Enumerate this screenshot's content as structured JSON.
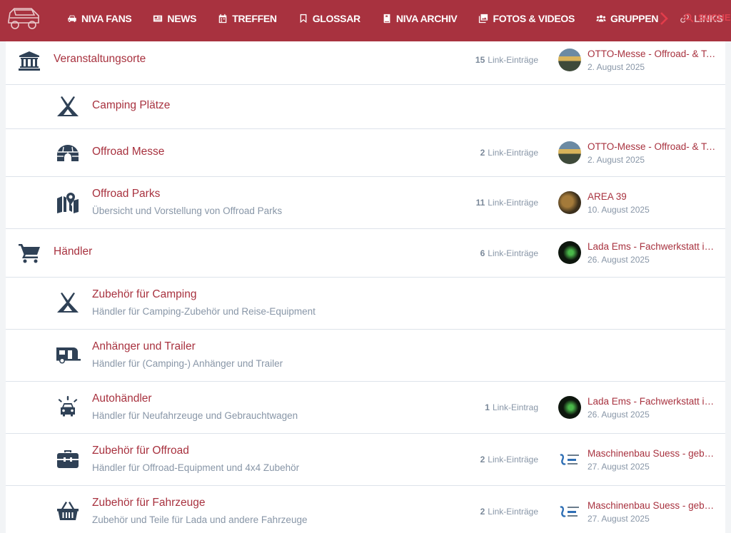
{
  "nav": {
    "items": [
      {
        "label": "NIVA FANS",
        "icon": "car-icon"
      },
      {
        "label": "NEWS",
        "icon": "newspaper-icon"
      },
      {
        "label": "TREFFEN",
        "icon": "calendar-icon"
      },
      {
        "label": "GLOSSAR",
        "icon": "bookmark-icon"
      },
      {
        "label": "NIVA ARCHIV",
        "icon": "book-icon"
      },
      {
        "label": "FOTOS & VIDEOS",
        "icon": "images-icon"
      },
      {
        "label": "GRUPPEN",
        "icon": "users-icon"
      },
      {
        "label": "LINKS",
        "icon": "link-icon"
      }
    ],
    "search_label": "SUCHE"
  },
  "rows": [
    {
      "icon": "institution-icon",
      "title": "Veranstaltungsorte",
      "description": "",
      "count": "15",
      "count_label": "Link-Einträge",
      "latest_title": "OTTO-Messe - Offroad- & Tech...",
      "latest_date": "2. August 2025",
      "avatar": "otto"
    },
    {
      "icon": "tent-icon",
      "title": "Camping Plätze",
      "description": "",
      "count": "",
      "count_label": "",
      "latest_title": "",
      "latest_date": "",
      "avatar": ""
    },
    {
      "icon": "igloo-icon",
      "title": "Offroad Messe",
      "description": "",
      "count": "2",
      "count_label": "Link-Einträge",
      "latest_title": "OTTO-Messe - Offroad- & Tech...",
      "latest_date": "2. August 2025",
      "avatar": "otto"
    },
    {
      "icon": "map-marker-icon",
      "title": "Offroad Parks",
      "description": "Übersicht und Vorstellung von Offroad Parks",
      "count": "11",
      "count_label": "Link-Einträge",
      "latest_title": "AREA 39",
      "latest_date": "10. August 2025",
      "avatar": "area"
    },
    {
      "icon": "shopping-cart-icon",
      "title": "Händler",
      "description": "",
      "count": "6",
      "count_label": "Link-Einträge",
      "latest_title": "Lada Ems - Fachwerkstatt in...",
      "latest_date": "26. August 2025",
      "avatar": "lada"
    },
    {
      "icon": "tent-icon",
      "title": "Zubehör für Camping",
      "description": "Händler für Camping-Zubehör und Reise-Equipment",
      "count": "",
      "count_label": "",
      "latest_title": "",
      "latest_date": "",
      "avatar": ""
    },
    {
      "icon": "caravan-icon",
      "title": "Anhänger und Trailer",
      "description": "Händler für (Camping-) Anhänger und Trailer",
      "count": "",
      "count_label": "",
      "latest_title": "",
      "latest_date": "",
      "avatar": ""
    },
    {
      "icon": "car-alert-icon",
      "title": "Autohändler",
      "description": "Händler für Neufahrzeuge und Gebrauchtwagen",
      "count": "1",
      "count_label": "Link-Eintrag",
      "latest_title": "Lada Ems - Fachwerkstatt in...",
      "latest_date": "26. August 2025",
      "avatar": "lada"
    },
    {
      "icon": "toolbox-icon",
      "title": "Zubehör für Offroad",
      "description": "Händler für Offroad-Equipment und 4x4 Zubehör",
      "count": "2",
      "count_label": "Link-Einträge",
      "latest_title": "Maschinenbau Suess - gebla...",
      "latest_date": "27. August 2025",
      "avatar": "suess"
    },
    {
      "icon": "shopping-basket-icon",
      "title": "Zubehör für Fahrzeuge",
      "description": "Zubehör und Teile für Lada und andere Fahrzeuge",
      "count": "2",
      "count_label": "Link-Einträge",
      "latest_title": "Maschinenbau Suess - gebla...",
      "latest_date": "27. August 2025",
      "avatar": "suess"
    }
  ]
}
